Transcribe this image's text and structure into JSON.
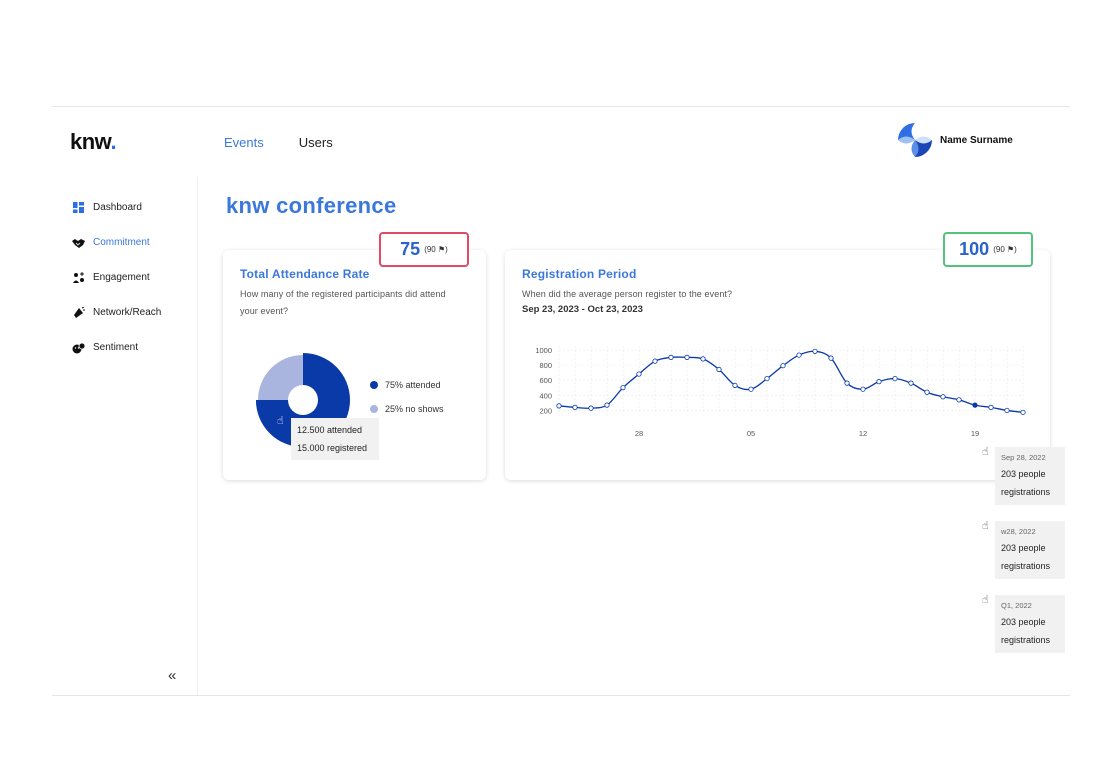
{
  "brand": {
    "name": "knw",
    "dot": "."
  },
  "nav": {
    "items": [
      {
        "label": "Events"
      },
      {
        "label": "Users"
      }
    ]
  },
  "user": {
    "name": "Name Surname"
  },
  "sidebar": {
    "items": [
      {
        "label": "Dashboard",
        "icon": "dashboard-icon"
      },
      {
        "label": "Commitment",
        "icon": "handshake-icon"
      },
      {
        "label": "Engagement",
        "icon": "engagement-icon"
      },
      {
        "label": "Network/Reach",
        "icon": "megaphone-icon"
      },
      {
        "label": "Sentiment",
        "icon": "sentiment-icon"
      }
    ],
    "collapse_glyph": "«"
  },
  "page": {
    "title": "knw conference"
  },
  "attendance": {
    "title": "Total Attendance Rate",
    "subtitle_line1": "How many of the registered participants did attend",
    "subtitle_line2": "your event?",
    "score": "75",
    "score_ref": "(90",
    "legend": [
      {
        "label": "75% attended"
      },
      {
        "label": "25% no shows"
      }
    ],
    "tooltip_line1": "12.500 attended",
    "tooltip_line2": "15.000 registered"
  },
  "registration": {
    "title": "Registration Period",
    "subtitle": "When did the average person register to the event?",
    "date_range": "Sep 23, 2023 - Oct 23, 2023",
    "score": "100",
    "score_ref": "(90"
  },
  "tooltips": [
    {
      "period": "Sep 28, 2022",
      "line1": "203 people",
      "line2": "registrations"
    },
    {
      "period": "w28, 2022",
      "line1": "203 people",
      "line2": "registrations"
    },
    {
      "period": "Q1, 2022",
      "line1": "203 people",
      "line2": "registrations"
    }
  ],
  "colors": {
    "accent": "#3b78dc",
    "dark_blue": "#0a3aa8",
    "light_blue": "#a9b5de",
    "red_border": "#e04a64",
    "green_border": "#52c27c"
  },
  "chart_data": [
    {
      "type": "pie",
      "labels": [
        "attended",
        "no shows"
      ],
      "values": [
        75,
        25
      ],
      "colors": [
        "#0a3aa8",
        "#a9b5de"
      ]
    },
    {
      "type": "line",
      "x": [
        0,
        1,
        2,
        3,
        4,
        5,
        6,
        7,
        8,
        9,
        10,
        11,
        12,
        13,
        14,
        15,
        16,
        17,
        18,
        19,
        20,
        21,
        22,
        23,
        24,
        25,
        26,
        27,
        28,
        29
      ],
      "y": [
        260,
        240,
        230,
        270,
        500,
        680,
        850,
        900,
        900,
        880,
        740,
        530,
        480,
        620,
        790,
        930,
        980,
        890,
        560,
        480,
        580,
        620,
        560,
        440,
        380,
        340,
        270,
        240,
        200,
        175
      ],
      "xticks": [
        {
          "x": 5,
          "label": "28"
        },
        {
          "x": 12,
          "label": "05"
        },
        {
          "x": 19,
          "label": "12"
        },
        {
          "x": 26,
          "label": "19"
        }
      ],
      "yticks": [
        200,
        400,
        600,
        800,
        1000
      ],
      "ylim": [
        100,
        1050
      ],
      "highlight_index": 26,
      "grid": true
    }
  ]
}
